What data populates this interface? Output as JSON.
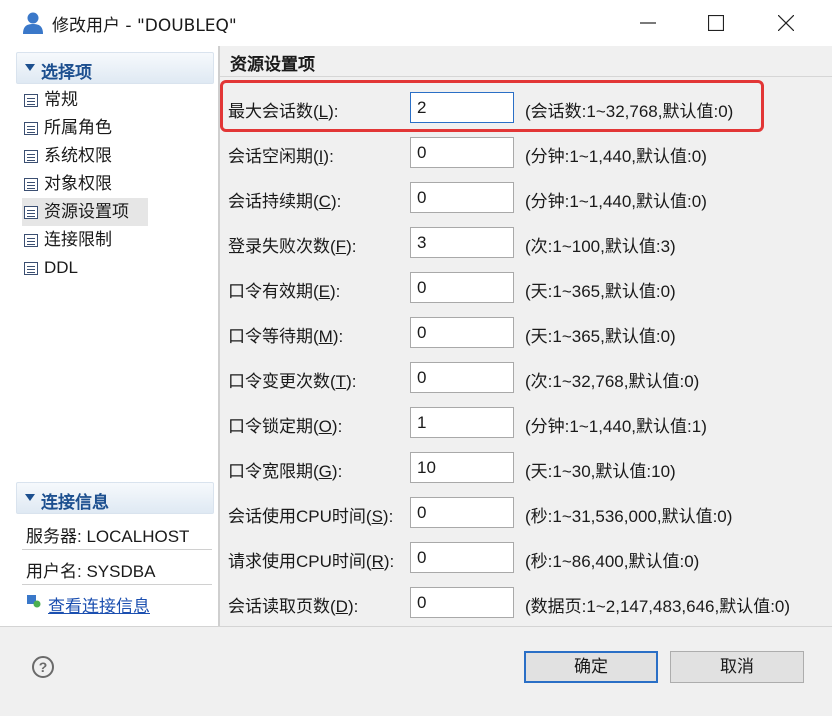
{
  "window": {
    "title": "修改用户 - \"DOUBLEQ\""
  },
  "left": {
    "section1_title": "选择项",
    "nav": [
      "常规",
      "所属角色",
      "系统权限",
      "对象权限",
      "资源设置项",
      "连接限制",
      "DDL"
    ],
    "selected_nav": "资源设置项",
    "section2_title": "连接信息",
    "server": "服务器: LOCALHOST",
    "user": "用户名: SYSDBA",
    "view_link": "查看连接信息"
  },
  "right": {
    "heading": "资源设置项",
    "rows": [
      {
        "label": "最大会话数(L):",
        "key": "L",
        "value": "2",
        "hint": "(会话数:1~32,768,默认值:0)"
      },
      {
        "label": "会话空闲期(I):",
        "key": "I",
        "value": "0",
        "hint": "(分钟:1~1,440,默认值:0)"
      },
      {
        "label": "会话持续期(C):",
        "key": "C",
        "value": "0",
        "hint": "(分钟:1~1,440,默认值:0)"
      },
      {
        "label": "登录失败次数(F):",
        "key": "F",
        "value": "3",
        "hint": "(次:1~100,默认值:3)"
      },
      {
        "label": "口令有效期(E):",
        "key": "E",
        "value": "0",
        "hint": "(天:1~365,默认值:0)"
      },
      {
        "label": "口令等待期(M):",
        "key": "M",
        "value": "0",
        "hint": "(天:1~365,默认值:0)"
      },
      {
        "label": "口令变更次数(T):",
        "key": "T",
        "value": "0",
        "hint": "(次:1~32,768,默认值:0)"
      },
      {
        "label": "口令锁定期(O):",
        "key": "O",
        "value": "1",
        "hint": "(分钟:1~1,440,默认值:1)"
      },
      {
        "label": "口令宽限期(G):",
        "key": "G",
        "value": "10",
        "hint": "(天:1~30,默认值:10)"
      },
      {
        "label": "会话使用CPU时间(S):",
        "key": "S",
        "value": "0",
        "hint": "(秒:1~31,536,000,默认值:0)"
      },
      {
        "label": "请求使用CPU时间(R):",
        "key": "R",
        "value": "0",
        "hint": "(秒:1~86,400,默认值:0)"
      },
      {
        "label": "会话读取页数(D):",
        "key": "D",
        "value": "0",
        "hint": "(数据页:1~2,147,483,646,默认值:0)"
      }
    ]
  },
  "buttons": {
    "ok": "确定",
    "cancel": "取消",
    "help": "?"
  },
  "colors": {
    "accent": "#2a6fc6",
    "highlight": "#e23636",
    "section_text": "#1c4f8f"
  },
  "icons": [
    "user-icon",
    "minimize-icon",
    "maximize-icon",
    "close-icon",
    "collapse-triangle-icon",
    "document-icon",
    "connection-info-icon",
    "help-icon"
  ]
}
